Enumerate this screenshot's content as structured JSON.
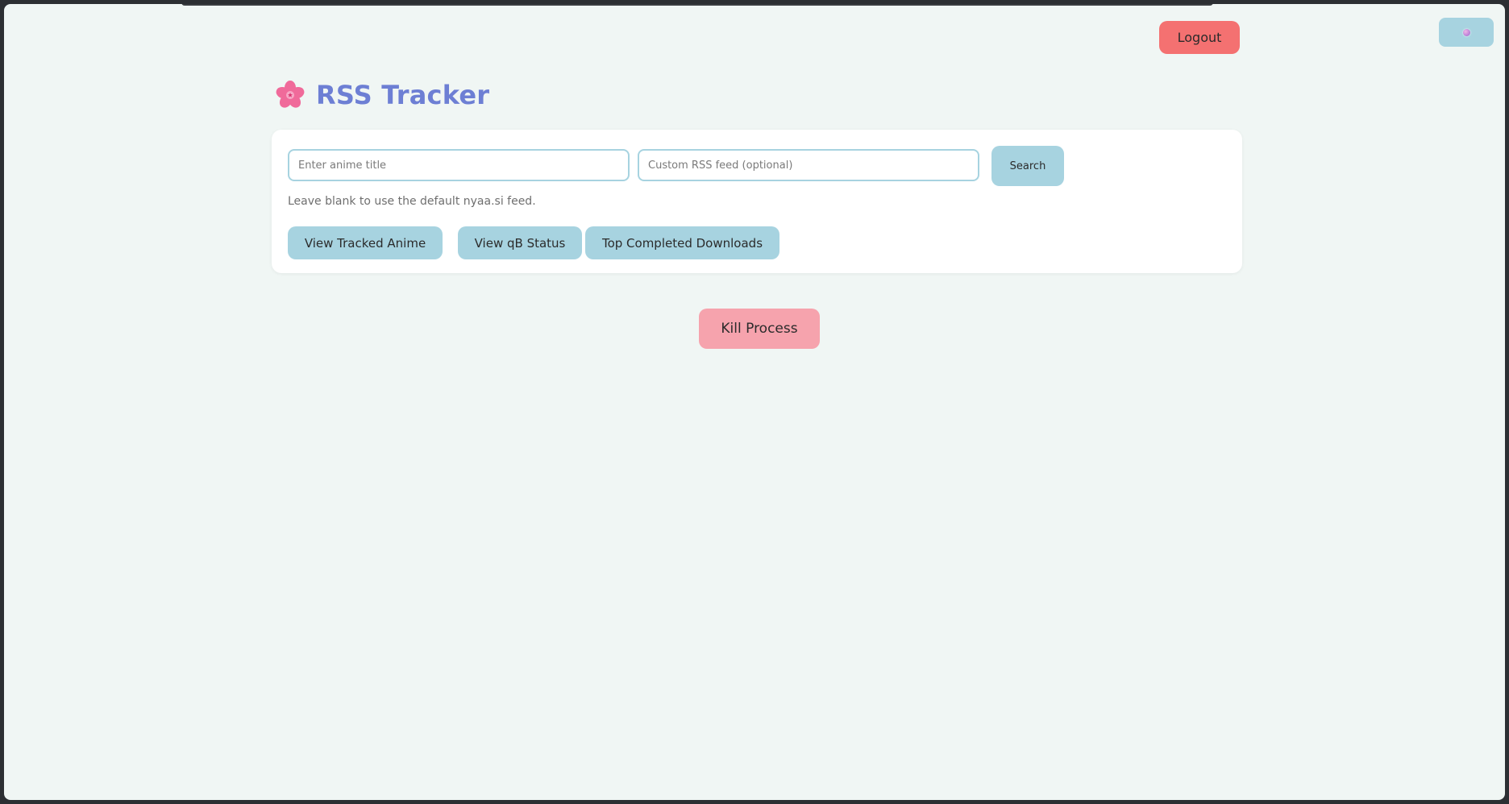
{
  "header": {
    "title": "RSS Tracker",
    "logo_icon": "cherry-blossom-icon"
  },
  "topbar": {
    "logout_label": "Logout",
    "theme_toggle_icon": "moon-icon"
  },
  "search": {
    "anime_placeholder": "Enter anime title",
    "anime_value": "",
    "rss_placeholder": "Custom RSS feed (optional)",
    "rss_value": "",
    "search_label": "Search",
    "hint": "Leave blank to use the default nyaa.si feed."
  },
  "actions": {
    "tracked_label": "View Tracked Anime",
    "qb_label": "View qB Status",
    "top_label": "Top Completed Downloads"
  },
  "kill": {
    "label": "Kill Process"
  },
  "colors": {
    "page_bg": "#f0f6f4",
    "accent": "#a7d3e0",
    "title": "#6d7fd4",
    "logout": "#f47171",
    "kill": "#f6a3ad"
  }
}
